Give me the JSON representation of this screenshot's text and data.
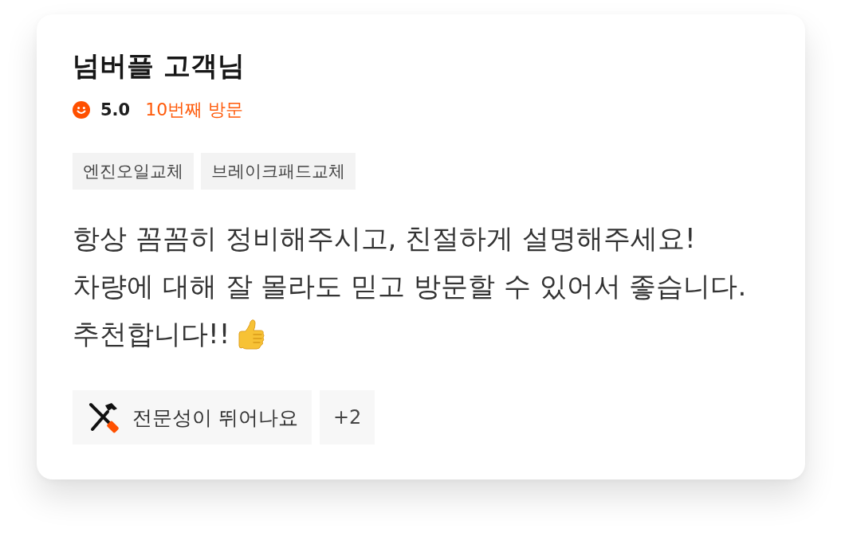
{
  "customer": {
    "name": "넘버플 고객님"
  },
  "rating": {
    "score": "5.0",
    "visits": "10번째 방문"
  },
  "tags": [
    "엔진오일교체",
    "브레이크패드교체"
  ],
  "review": {
    "lines": [
      "항상 꼼꼼히 정비해주시고, 친절하게 설명해주세요!",
      "차량에 대해 잘 몰라도 믿고 방문할 수 있어서 좋습니다.",
      "추천합니다!!"
    ]
  },
  "keywords": [
    {
      "kind": "tools",
      "label": "전문성이 뛰어나요"
    }
  ],
  "more_count": "+2"
}
